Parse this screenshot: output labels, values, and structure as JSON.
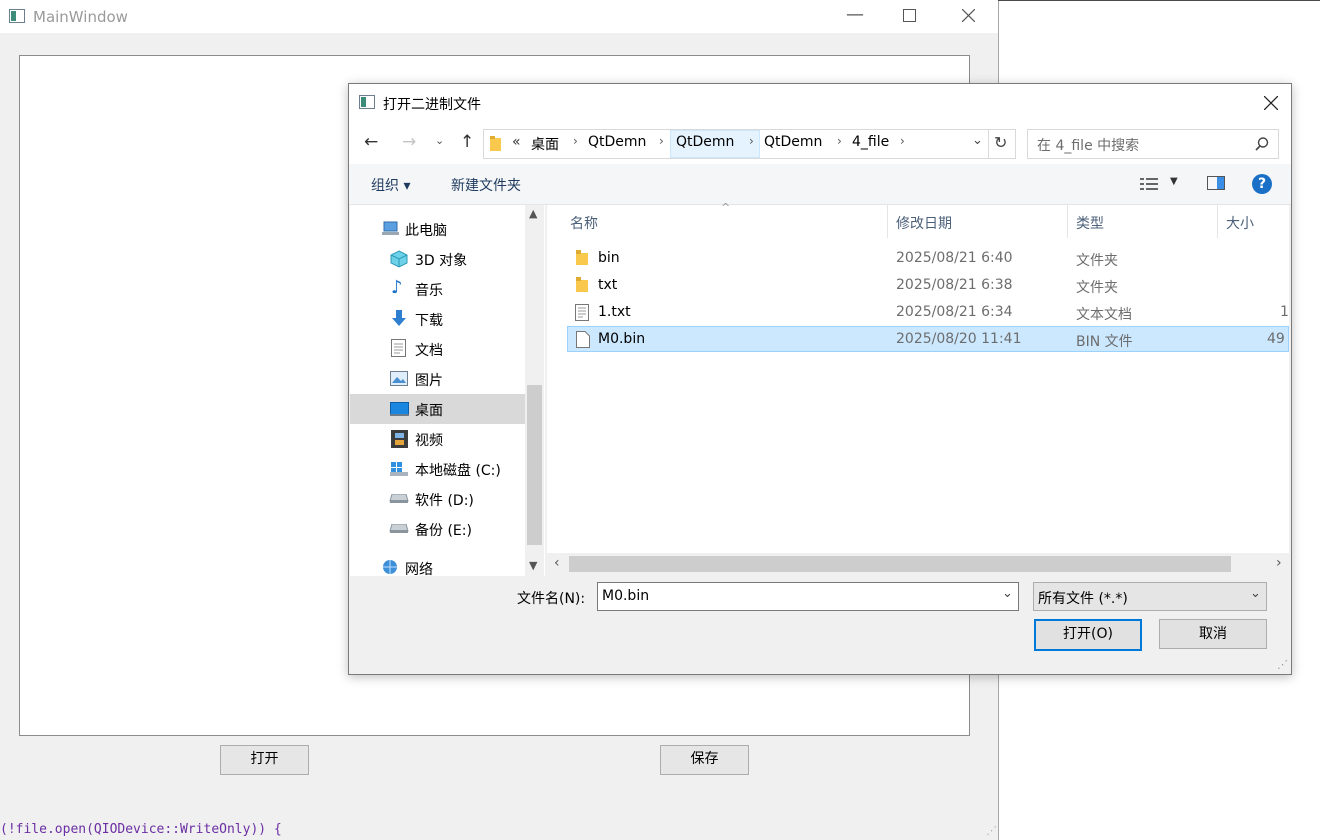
{
  "main_window": {
    "title": "MainWindow",
    "open_button": "打开",
    "save_button": "保存",
    "code_snippet": "(!file.open(QIODevice::WriteOnly)) {"
  },
  "dialog": {
    "title": "打开二进制文件",
    "address": {
      "overflow": "«",
      "crumbs": [
        "桌面",
        "QtDemn",
        "QtDemn",
        "QtDemn",
        "4_file"
      ]
    },
    "search_placeholder": "在 4_file 中搜索",
    "toolbar": {
      "organize": "组织 ▾",
      "new_folder": "新建文件夹",
      "help": "?"
    },
    "nav_items": [
      {
        "label": "此电脑",
        "icon": "computer-icon"
      },
      {
        "label": "3D 对象",
        "icon": "cube-icon"
      },
      {
        "label": "音乐",
        "icon": "music-icon"
      },
      {
        "label": "下载",
        "icon": "download-icon"
      },
      {
        "label": "文档",
        "icon": "document-icon"
      },
      {
        "label": "图片",
        "icon": "picture-icon"
      },
      {
        "label": "桌面",
        "icon": "desktop-icon"
      },
      {
        "label": "视频",
        "icon": "video-icon"
      },
      {
        "label": "本地磁盘 (C:)",
        "icon": "drive-icon"
      },
      {
        "label": "软件 (D:)",
        "icon": "drive-icon"
      },
      {
        "label": "备份 (E:)",
        "icon": "drive-icon"
      },
      {
        "label": "网络",
        "icon": "network-icon"
      }
    ],
    "columns": {
      "name": "名称",
      "modified": "修改日期",
      "type": "类型",
      "size": "大小"
    },
    "files": [
      {
        "name": "bin",
        "modified": "2025/08/21 6:40",
        "type": "文件夹",
        "size": ""
      },
      {
        "name": "txt",
        "modified": "2025/08/21 6:38",
        "type": "文件夹",
        "size": ""
      },
      {
        "name": "1.txt",
        "modified": "2025/08/21 6:34",
        "type": "文本文档",
        "size": "1"
      },
      {
        "name": "M0.bin",
        "modified": "2025/08/20 11:41",
        "type": "BIN 文件",
        "size": "49"
      }
    ],
    "filename_label": "文件名(N):",
    "filename_value": "M0.bin",
    "filter_value": "所有文件 (*.*)",
    "open_button": "打开(O)",
    "cancel_button": "取消"
  },
  "colors": {
    "selection": "#cce8ff",
    "accent": "#0078d7",
    "folder": "#f8c94c"
  }
}
